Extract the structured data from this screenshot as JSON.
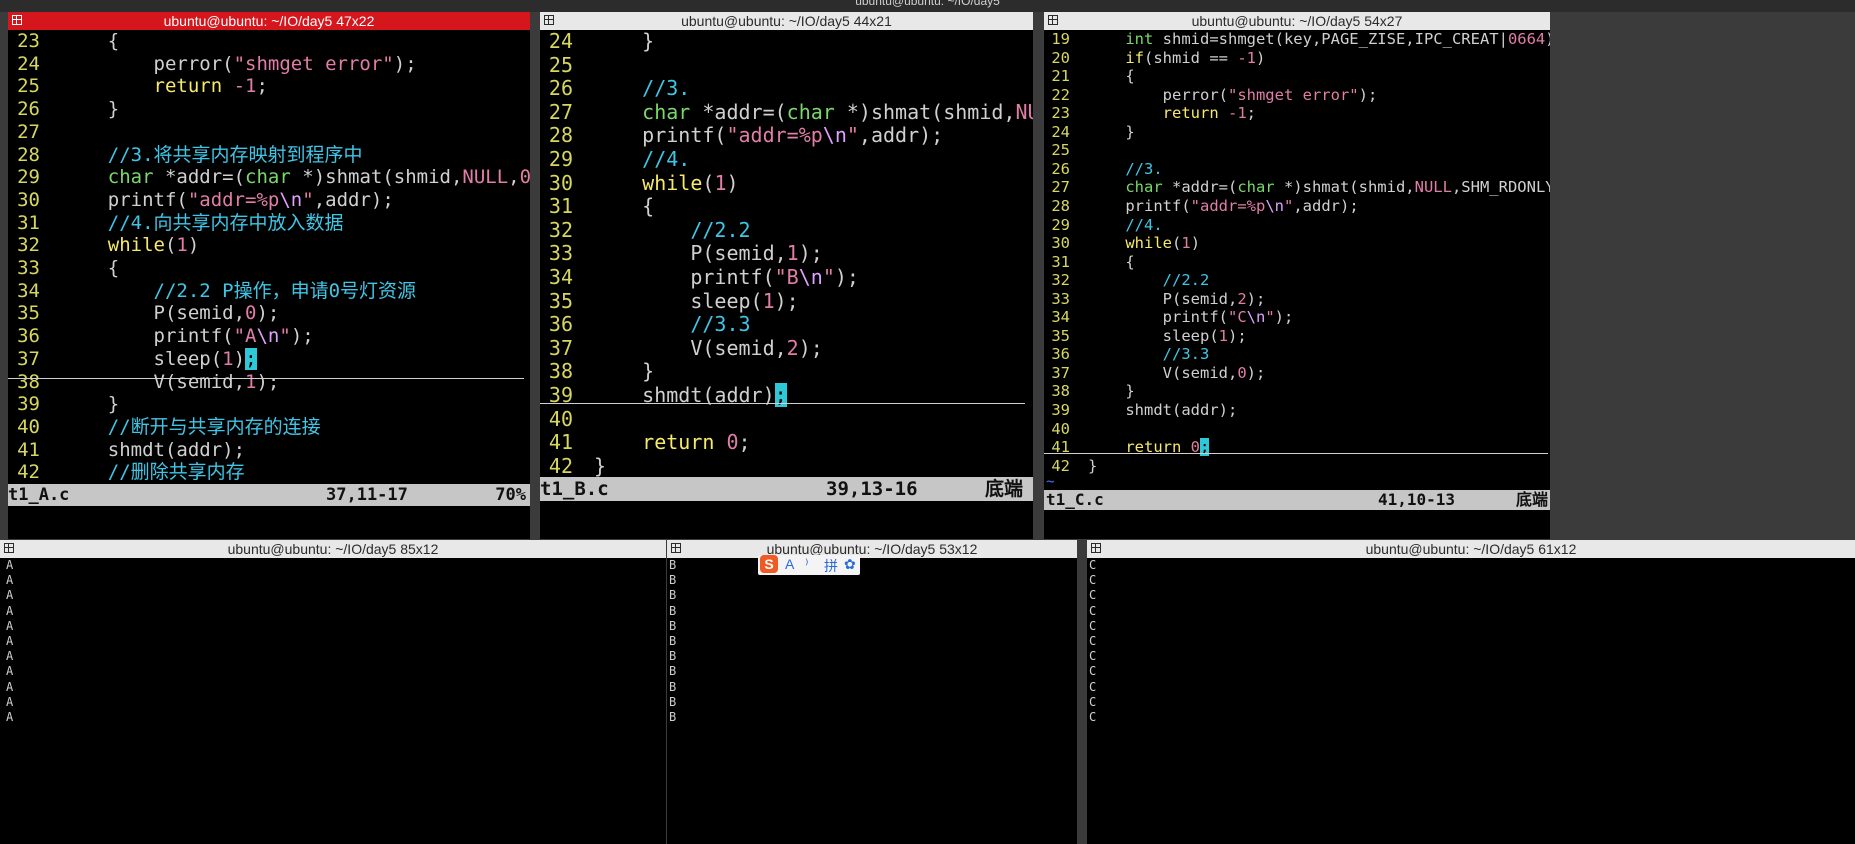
{
  "desktop": {
    "top_title": "ubuntu@ubuntu: ~/IO/day5"
  },
  "windows": {
    "a": {
      "title": "ubuntu@ubuntu: ~/IO/day5 47x22",
      "status_file": "t1_A.c",
      "status_pos": "37,11-17",
      "status_pct": "70%"
    },
    "b": {
      "title": "ubuntu@ubuntu: ~/IO/day5 44x21",
      "status_file": "t1_B.c",
      "status_pos": "39,13-16",
      "status_pct": "底端"
    },
    "c": {
      "title": "ubuntu@ubuntu: ~/IO/day5 54x27",
      "status_file": "t1_C.c",
      "status_pos": "41,10-13",
      "status_pct": "底端",
      "tilde": "~"
    },
    "d": {
      "title": "ubuntu@ubuntu: ~/IO/day5 85x12",
      "lines": [
        "A",
        "A",
        "A",
        "A",
        "A",
        "A",
        "A",
        "A",
        "A",
        "A",
        "A"
      ]
    },
    "e": {
      "title": "ubuntu@ubuntu: ~/IO/day5 53x12",
      "lines": [
        "B",
        "B",
        "B",
        "B",
        "B",
        "B",
        "B",
        "B",
        "B",
        "B",
        "B"
      ]
    },
    "f": {
      "title": "ubuntu@ubuntu: ~/IO/day5 61x12",
      "lines": [
        "C",
        "C",
        "C",
        "C",
        "C",
        "C",
        "C",
        "C",
        "C",
        "C",
        "C"
      ]
    }
  },
  "code": {
    "a": [
      {
        "n": "23",
        "segs": [
          {
            "t": "    {",
            "k": ""
          }
        ]
      },
      {
        "n": "24",
        "segs": [
          {
            "t": "        perror(",
            "k": ""
          },
          {
            "t": "\"shmget error\"",
            "k": "str"
          },
          {
            "t": ");",
            "k": ""
          }
        ]
      },
      {
        "n": "25",
        "segs": [
          {
            "t": "        ",
            "k": ""
          },
          {
            "t": "return",
            "k": "kw"
          },
          {
            "t": " ",
            "k": ""
          },
          {
            "t": "-1",
            "k": "num"
          },
          {
            "t": ";",
            "k": ""
          }
        ]
      },
      {
        "n": "26",
        "segs": [
          {
            "t": "    }",
            "k": ""
          }
        ]
      },
      {
        "n": "27",
        "segs": [
          {
            "t": "",
            "k": ""
          }
        ]
      },
      {
        "n": "28",
        "segs": [
          {
            "t": "    ",
            "k": ""
          },
          {
            "t": "//3.将共享内存映射到程序中",
            "k": "cm"
          }
        ]
      },
      {
        "n": "29",
        "segs": [
          {
            "t": "    ",
            "k": ""
          },
          {
            "t": "char",
            "k": "ty"
          },
          {
            "t": " *addr=(",
            "k": ""
          },
          {
            "t": "char",
            "k": "ty"
          },
          {
            "t": " *)shmat(shmid,",
            "k": ""
          },
          {
            "t": "NULL",
            "k": "str"
          },
          {
            "t": ",",
            "k": ""
          },
          {
            "t": "0",
            "k": "num"
          },
          {
            "t": ");",
            "k": ""
          }
        ]
      },
      {
        "n": "30",
        "segs": [
          {
            "t": "    printf(",
            "k": ""
          },
          {
            "t": "\"addr=%p",
            "k": "str"
          },
          {
            "t": "\\n",
            "k": "esc"
          },
          {
            "t": "\"",
            "k": "str"
          },
          {
            "t": ",addr);",
            "k": ""
          }
        ]
      },
      {
        "n": "31",
        "segs": [
          {
            "t": "    ",
            "k": ""
          },
          {
            "t": "//4.向共享内存中放入数据",
            "k": "cm"
          }
        ]
      },
      {
        "n": "32",
        "segs": [
          {
            "t": "    ",
            "k": ""
          },
          {
            "t": "while",
            "k": "kw"
          },
          {
            "t": "(",
            "k": ""
          },
          {
            "t": "1",
            "k": "num"
          },
          {
            "t": ")",
            "k": ""
          }
        ]
      },
      {
        "n": "33",
        "segs": [
          {
            "t": "    {",
            "k": ""
          }
        ]
      },
      {
        "n": "34",
        "segs": [
          {
            "t": "        ",
            "k": ""
          },
          {
            "t": "//2.2 P操作，申请0号灯资源",
            "k": "cm"
          }
        ]
      },
      {
        "n": "35",
        "segs": [
          {
            "t": "        P(semid,",
            "k": ""
          },
          {
            "t": "0",
            "k": "num"
          },
          {
            "t": ");",
            "k": ""
          }
        ]
      },
      {
        "n": "36",
        "segs": [
          {
            "t": "        printf(",
            "k": ""
          },
          {
            "t": "\"A",
            "k": "str"
          },
          {
            "t": "\\n",
            "k": "esc"
          },
          {
            "t": "\"",
            "k": "str"
          },
          {
            "t": ");",
            "k": ""
          }
        ]
      },
      {
        "n": "37",
        "segs": [
          {
            "t": "        sleep(",
            "k": ""
          },
          {
            "t": "1",
            "k": "num"
          },
          {
            "t": ")",
            "k": ""
          },
          {
            "t": ";",
            "k": "cursor"
          }
        ]
      },
      {
        "n": "38",
        "segs": [
          {
            "t": "        V(semid,",
            "k": ""
          },
          {
            "t": "1",
            "k": "num"
          },
          {
            "t": ");",
            "k": ""
          }
        ]
      },
      {
        "n": "39",
        "segs": [
          {
            "t": "    }",
            "k": ""
          }
        ]
      },
      {
        "n": "40",
        "segs": [
          {
            "t": "    ",
            "k": ""
          },
          {
            "t": "//断开与共享内存的连接",
            "k": "cm"
          }
        ]
      },
      {
        "n": "41",
        "segs": [
          {
            "t": "    shmdt(addr);",
            "k": ""
          }
        ]
      },
      {
        "n": "42",
        "segs": [
          {
            "t": "    ",
            "k": ""
          },
          {
            "t": "//删除共享内存",
            "k": "cm"
          }
        ]
      }
    ],
    "b": [
      {
        "n": "24",
        "segs": [
          {
            "t": "    }",
            "k": ""
          }
        ]
      },
      {
        "n": "25",
        "segs": [
          {
            "t": "",
            "k": ""
          }
        ]
      },
      {
        "n": "26",
        "segs": [
          {
            "t": "    ",
            "k": ""
          },
          {
            "t": "//3.",
            "k": "cm"
          }
        ]
      },
      {
        "n": "27",
        "segs": [
          {
            "t": "    ",
            "k": ""
          },
          {
            "t": "char",
            "k": "ty"
          },
          {
            "t": " *addr=(",
            "k": ""
          },
          {
            "t": "char",
            "k": "ty"
          },
          {
            "t": " *)shmat(shmid,",
            "k": ""
          },
          {
            "t": "NULL",
            "k": "str"
          },
          {
            "t": ",",
            "k": ""
          }
        ]
      },
      {
        "n": "28",
        "segs": [
          {
            "t": "    printf(",
            "k": ""
          },
          {
            "t": "\"addr=%p",
            "k": "str"
          },
          {
            "t": "\\n",
            "k": "esc"
          },
          {
            "t": "\"",
            "k": "str"
          },
          {
            "t": ",addr);",
            "k": ""
          }
        ]
      },
      {
        "n": "29",
        "segs": [
          {
            "t": "    ",
            "k": ""
          },
          {
            "t": "//4.",
            "k": "cm"
          }
        ]
      },
      {
        "n": "30",
        "segs": [
          {
            "t": "    ",
            "k": ""
          },
          {
            "t": "while",
            "k": "kw"
          },
          {
            "t": "(",
            "k": ""
          },
          {
            "t": "1",
            "k": "num"
          },
          {
            "t": ")",
            "k": ""
          }
        ]
      },
      {
        "n": "31",
        "segs": [
          {
            "t": "    {",
            "k": ""
          }
        ]
      },
      {
        "n": "32",
        "segs": [
          {
            "t": "        ",
            "k": ""
          },
          {
            "t": "//2.2",
            "k": "cm"
          }
        ]
      },
      {
        "n": "33",
        "segs": [
          {
            "t": "        P(semid,",
            "k": ""
          },
          {
            "t": "1",
            "k": "num"
          },
          {
            "t": ");",
            "k": ""
          }
        ]
      },
      {
        "n": "34",
        "segs": [
          {
            "t": "        printf(",
            "k": ""
          },
          {
            "t": "\"B",
            "k": "str"
          },
          {
            "t": "\\n",
            "k": "esc"
          },
          {
            "t": "\"",
            "k": "str"
          },
          {
            "t": ");",
            "k": ""
          }
        ]
      },
      {
        "n": "35",
        "segs": [
          {
            "t": "        sleep(",
            "k": ""
          },
          {
            "t": "1",
            "k": "num"
          },
          {
            "t": ");",
            "k": ""
          }
        ]
      },
      {
        "n": "36",
        "segs": [
          {
            "t": "        ",
            "k": ""
          },
          {
            "t": "//3.3",
            "k": "cm"
          }
        ]
      },
      {
        "n": "37",
        "segs": [
          {
            "t": "        V(semid,",
            "k": ""
          },
          {
            "t": "2",
            "k": "num"
          },
          {
            "t": ");",
            "k": ""
          }
        ]
      },
      {
        "n": "38",
        "segs": [
          {
            "t": "    }",
            "k": ""
          }
        ]
      },
      {
        "n": "39",
        "segs": [
          {
            "t": "    shmdt(addr)",
            "k": ""
          },
          {
            "t": ";",
            "k": "cursor"
          }
        ]
      },
      {
        "n": "40",
        "segs": [
          {
            "t": "",
            "k": ""
          }
        ]
      },
      {
        "n": "41",
        "segs": [
          {
            "t": "    ",
            "k": ""
          },
          {
            "t": "return",
            "k": "kw"
          },
          {
            "t": " ",
            "k": ""
          },
          {
            "t": "0",
            "k": "num"
          },
          {
            "t": ";",
            "k": ""
          }
        ]
      },
      {
        "n": "42",
        "segs": [
          {
            "t": "}",
            "k": ""
          }
        ]
      }
    ],
    "c": [
      {
        "n": "19",
        "segs": [
          {
            "t": "    ",
            "k": ""
          },
          {
            "t": "int",
            "k": "ty"
          },
          {
            "t": " shmid=shmget(key,PAGE_ZISE,IPC_CREAT|",
            "k": ""
          },
          {
            "t": "0664",
            "k": "num"
          },
          {
            "t": ")",
            "k": ""
          }
        ]
      },
      {
        "n": "20",
        "segs": [
          {
            "t": "    ",
            "k": ""
          },
          {
            "t": "if",
            "k": "kw"
          },
          {
            "t": "(shmid == ",
            "k": ""
          },
          {
            "t": "-1",
            "k": "num"
          },
          {
            "t": ")",
            "k": ""
          }
        ]
      },
      {
        "n": "21",
        "segs": [
          {
            "t": "    {",
            "k": ""
          }
        ]
      },
      {
        "n": "22",
        "segs": [
          {
            "t": "        perror(",
            "k": ""
          },
          {
            "t": "\"shmget error\"",
            "k": "str"
          },
          {
            "t": ");",
            "k": ""
          }
        ]
      },
      {
        "n": "23",
        "segs": [
          {
            "t": "        ",
            "k": ""
          },
          {
            "t": "return",
            "k": "kw"
          },
          {
            "t": " ",
            "k": ""
          },
          {
            "t": "-1",
            "k": "num"
          },
          {
            "t": ";",
            "k": ""
          }
        ]
      },
      {
        "n": "24",
        "segs": [
          {
            "t": "    }",
            "k": ""
          }
        ]
      },
      {
        "n": "25",
        "segs": [
          {
            "t": "",
            "k": ""
          }
        ]
      },
      {
        "n": "26",
        "segs": [
          {
            "t": "    ",
            "k": ""
          },
          {
            "t": "//3.",
            "k": "cm"
          }
        ]
      },
      {
        "n": "27",
        "segs": [
          {
            "t": "    ",
            "k": ""
          },
          {
            "t": "char",
            "k": "ty"
          },
          {
            "t": " *addr=(",
            "k": ""
          },
          {
            "t": "char",
            "k": "ty"
          },
          {
            "t": " *)shmat(shmid,",
            "k": ""
          },
          {
            "t": "NULL",
            "k": "str"
          },
          {
            "t": ",SHM_RDONLY",
            "k": ""
          }
        ]
      },
      {
        "n": "28",
        "segs": [
          {
            "t": "    printf(",
            "k": ""
          },
          {
            "t": "\"addr=%p",
            "k": "str"
          },
          {
            "t": "\\n",
            "k": "esc"
          },
          {
            "t": "\"",
            "k": "str"
          },
          {
            "t": ",addr);",
            "k": ""
          }
        ]
      },
      {
        "n": "29",
        "segs": [
          {
            "t": "    ",
            "k": ""
          },
          {
            "t": "//4.",
            "k": "cm"
          }
        ]
      },
      {
        "n": "30",
        "segs": [
          {
            "t": "    ",
            "k": ""
          },
          {
            "t": "while",
            "k": "kw"
          },
          {
            "t": "(",
            "k": ""
          },
          {
            "t": "1",
            "k": "num"
          },
          {
            "t": ")",
            "k": ""
          }
        ]
      },
      {
        "n": "31",
        "segs": [
          {
            "t": "    {",
            "k": ""
          }
        ]
      },
      {
        "n": "32",
        "segs": [
          {
            "t": "        ",
            "k": ""
          },
          {
            "t": "//2.2",
            "k": "cm"
          }
        ]
      },
      {
        "n": "33",
        "segs": [
          {
            "t": "        P(semid,",
            "k": ""
          },
          {
            "t": "2",
            "k": "num"
          },
          {
            "t": ");",
            "k": ""
          }
        ]
      },
      {
        "n": "34",
        "segs": [
          {
            "t": "        printf(",
            "k": ""
          },
          {
            "t": "\"C",
            "k": "str"
          },
          {
            "t": "\\n",
            "k": "esc"
          },
          {
            "t": "\"",
            "k": "str"
          },
          {
            "t": ");",
            "k": ""
          }
        ]
      },
      {
        "n": "35",
        "segs": [
          {
            "t": "        sleep(",
            "k": ""
          },
          {
            "t": "1",
            "k": "num"
          },
          {
            "t": ");",
            "k": ""
          }
        ]
      },
      {
        "n": "36",
        "segs": [
          {
            "t": "        ",
            "k": ""
          },
          {
            "t": "//3.3",
            "k": "cm"
          }
        ]
      },
      {
        "n": "37",
        "segs": [
          {
            "t": "        V(semid,",
            "k": ""
          },
          {
            "t": "0",
            "k": "num"
          },
          {
            "t": ");",
            "k": ""
          }
        ]
      },
      {
        "n": "38",
        "segs": [
          {
            "t": "    }",
            "k": ""
          }
        ]
      },
      {
        "n": "39",
        "segs": [
          {
            "t": "    shmdt(addr);",
            "k": ""
          }
        ]
      },
      {
        "n": "40",
        "segs": [
          {
            "t": "",
            "k": ""
          }
        ]
      },
      {
        "n": "41",
        "segs": [
          {
            "t": "    ",
            "k": ""
          },
          {
            "t": "return",
            "k": "kw"
          },
          {
            "t": " ",
            "k": ""
          },
          {
            "t": "0",
            "k": "num"
          },
          {
            "t": ";",
            "k": "cursor"
          }
        ]
      },
      {
        "n": "42",
        "segs": [
          {
            "t": "}",
            "k": ""
          }
        ]
      }
    ]
  },
  "ime": {
    "logo": "S",
    "lang": "A",
    "punct": "⁾",
    "mode": "拼",
    "settings": "✿"
  },
  "colors": {
    "active_title": "#d5161c",
    "line_number": "#d7d75f",
    "keyword": "#f7e96a",
    "type": "#7ad76b",
    "string": "#e17ea6",
    "comment": "#3fc6e6",
    "cursor": "#2ec8d8"
  }
}
